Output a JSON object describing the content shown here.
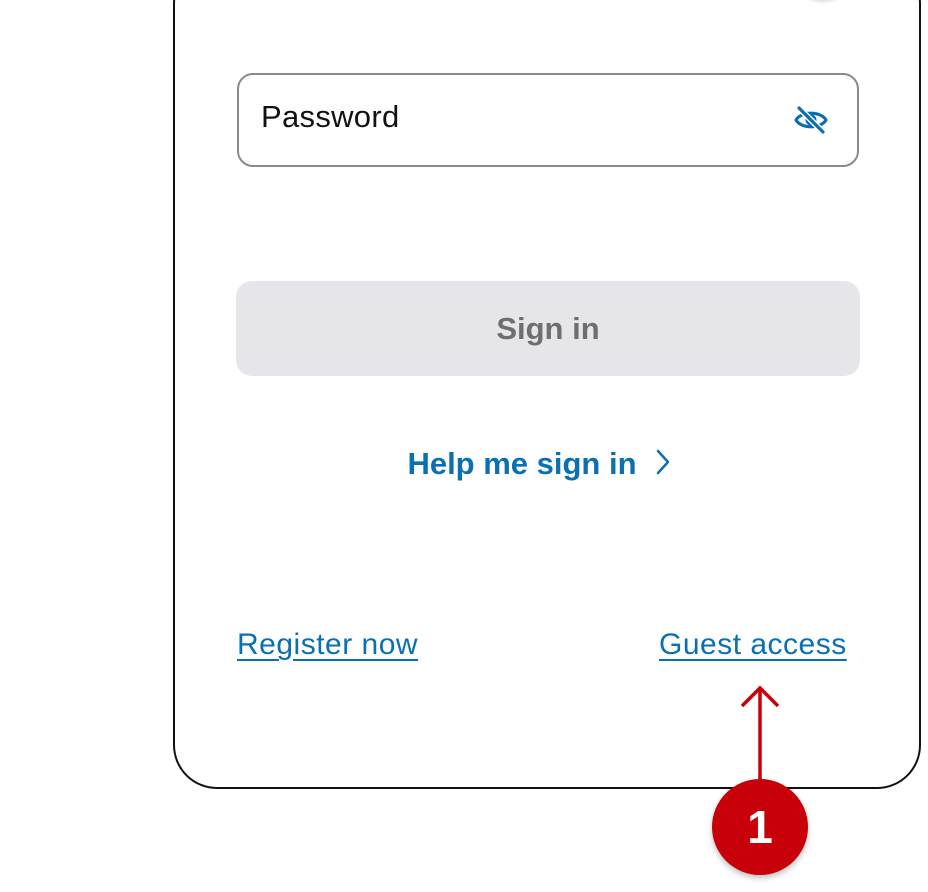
{
  "login_form": {
    "password_field": {
      "label": "Password",
      "visibility_icon": "eye-off-icon"
    },
    "sign_in_button": {
      "label": "Sign in",
      "state": "disabled"
    },
    "help_link": {
      "label": "Help me sign in",
      "icon": "chevron-right-icon"
    },
    "register_link": {
      "label": "Register now"
    },
    "guest_link": {
      "label": "Guest access"
    }
  },
  "annotation": {
    "step_number": "1",
    "arrow_icon": "arrow-up-icon",
    "color": "#c8000a"
  },
  "colors": {
    "accent": "#0a70b3",
    "button_disabled_bg": "#e5e5ea",
    "button_disabled_text": "#6e6e72",
    "field_border": "#8a8a8a"
  }
}
